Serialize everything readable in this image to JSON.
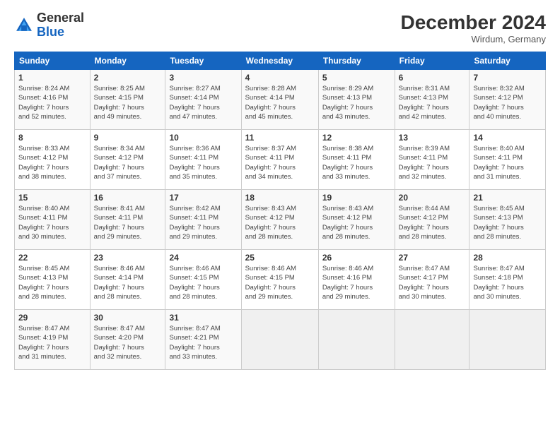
{
  "header": {
    "logo_general": "General",
    "logo_blue": "Blue",
    "month_title": "December 2024",
    "location": "Wirdum, Germany"
  },
  "days_of_week": [
    "Sunday",
    "Monday",
    "Tuesday",
    "Wednesday",
    "Thursday",
    "Friday",
    "Saturday"
  ],
  "weeks": [
    [
      {
        "day": "1",
        "detail": "Sunrise: 8:24 AM\nSunset: 4:16 PM\nDaylight: 7 hours\nand 52 minutes."
      },
      {
        "day": "2",
        "detail": "Sunrise: 8:25 AM\nSunset: 4:15 PM\nDaylight: 7 hours\nand 49 minutes."
      },
      {
        "day": "3",
        "detail": "Sunrise: 8:27 AM\nSunset: 4:14 PM\nDaylight: 7 hours\nand 47 minutes."
      },
      {
        "day": "4",
        "detail": "Sunrise: 8:28 AM\nSunset: 4:14 PM\nDaylight: 7 hours\nand 45 minutes."
      },
      {
        "day": "5",
        "detail": "Sunrise: 8:29 AM\nSunset: 4:13 PM\nDaylight: 7 hours\nand 43 minutes."
      },
      {
        "day": "6",
        "detail": "Sunrise: 8:31 AM\nSunset: 4:13 PM\nDaylight: 7 hours\nand 42 minutes."
      },
      {
        "day": "7",
        "detail": "Sunrise: 8:32 AM\nSunset: 4:12 PM\nDaylight: 7 hours\nand 40 minutes."
      }
    ],
    [
      {
        "day": "8",
        "detail": "Sunrise: 8:33 AM\nSunset: 4:12 PM\nDaylight: 7 hours\nand 38 minutes."
      },
      {
        "day": "9",
        "detail": "Sunrise: 8:34 AM\nSunset: 4:12 PM\nDaylight: 7 hours\nand 37 minutes."
      },
      {
        "day": "10",
        "detail": "Sunrise: 8:36 AM\nSunset: 4:11 PM\nDaylight: 7 hours\nand 35 minutes."
      },
      {
        "day": "11",
        "detail": "Sunrise: 8:37 AM\nSunset: 4:11 PM\nDaylight: 7 hours\nand 34 minutes."
      },
      {
        "day": "12",
        "detail": "Sunrise: 8:38 AM\nSunset: 4:11 PM\nDaylight: 7 hours\nand 33 minutes."
      },
      {
        "day": "13",
        "detail": "Sunrise: 8:39 AM\nSunset: 4:11 PM\nDaylight: 7 hours\nand 32 minutes."
      },
      {
        "day": "14",
        "detail": "Sunrise: 8:40 AM\nSunset: 4:11 PM\nDaylight: 7 hours\nand 31 minutes."
      }
    ],
    [
      {
        "day": "15",
        "detail": "Sunrise: 8:40 AM\nSunset: 4:11 PM\nDaylight: 7 hours\nand 30 minutes."
      },
      {
        "day": "16",
        "detail": "Sunrise: 8:41 AM\nSunset: 4:11 PM\nDaylight: 7 hours\nand 29 minutes."
      },
      {
        "day": "17",
        "detail": "Sunrise: 8:42 AM\nSunset: 4:11 PM\nDaylight: 7 hours\nand 29 minutes."
      },
      {
        "day": "18",
        "detail": "Sunrise: 8:43 AM\nSunset: 4:12 PM\nDaylight: 7 hours\nand 28 minutes."
      },
      {
        "day": "19",
        "detail": "Sunrise: 8:43 AM\nSunset: 4:12 PM\nDaylight: 7 hours\nand 28 minutes."
      },
      {
        "day": "20",
        "detail": "Sunrise: 8:44 AM\nSunset: 4:12 PM\nDaylight: 7 hours\nand 28 minutes."
      },
      {
        "day": "21",
        "detail": "Sunrise: 8:45 AM\nSunset: 4:13 PM\nDaylight: 7 hours\nand 28 minutes."
      }
    ],
    [
      {
        "day": "22",
        "detail": "Sunrise: 8:45 AM\nSunset: 4:13 PM\nDaylight: 7 hours\nand 28 minutes."
      },
      {
        "day": "23",
        "detail": "Sunrise: 8:46 AM\nSunset: 4:14 PM\nDaylight: 7 hours\nand 28 minutes."
      },
      {
        "day": "24",
        "detail": "Sunrise: 8:46 AM\nSunset: 4:15 PM\nDaylight: 7 hours\nand 28 minutes."
      },
      {
        "day": "25",
        "detail": "Sunrise: 8:46 AM\nSunset: 4:15 PM\nDaylight: 7 hours\nand 29 minutes."
      },
      {
        "day": "26",
        "detail": "Sunrise: 8:46 AM\nSunset: 4:16 PM\nDaylight: 7 hours\nand 29 minutes."
      },
      {
        "day": "27",
        "detail": "Sunrise: 8:47 AM\nSunset: 4:17 PM\nDaylight: 7 hours\nand 30 minutes."
      },
      {
        "day": "28",
        "detail": "Sunrise: 8:47 AM\nSunset: 4:18 PM\nDaylight: 7 hours\nand 30 minutes."
      }
    ],
    [
      {
        "day": "29",
        "detail": "Sunrise: 8:47 AM\nSunset: 4:19 PM\nDaylight: 7 hours\nand 31 minutes."
      },
      {
        "day": "30",
        "detail": "Sunrise: 8:47 AM\nSunset: 4:20 PM\nDaylight: 7 hours\nand 32 minutes."
      },
      {
        "day": "31",
        "detail": "Sunrise: 8:47 AM\nSunset: 4:21 PM\nDaylight: 7 hours\nand 33 minutes."
      },
      {
        "day": "",
        "detail": ""
      },
      {
        "day": "",
        "detail": ""
      },
      {
        "day": "",
        "detail": ""
      },
      {
        "day": "",
        "detail": ""
      }
    ]
  ]
}
